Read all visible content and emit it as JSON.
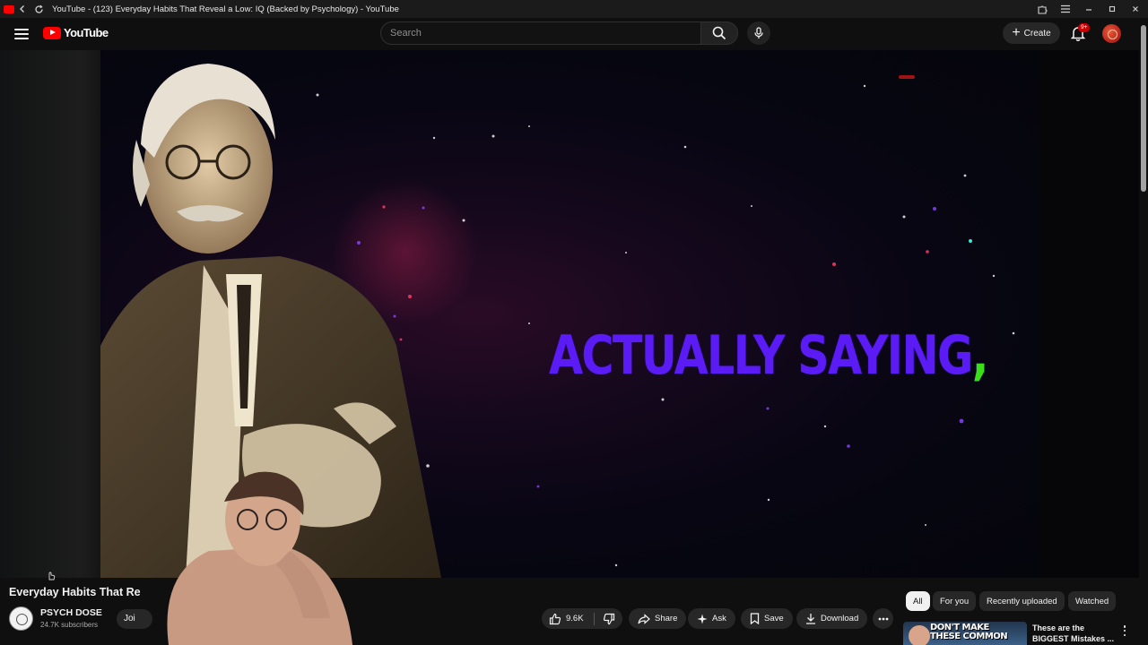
{
  "window": {
    "title": "YouTube - (123) Everyday Habits That Reveal a Low: IQ (Backed by Psychology) - YouTube"
  },
  "masthead": {
    "logo_text": "YouTube",
    "search_placeholder": "Search",
    "create_label": "Create",
    "notification_count": "9+"
  },
  "player": {
    "caption_text": "ACTUALLY SAYING",
    "caption_punct": ",",
    "caption_color": "#5a1bf4",
    "punct_color": "#39e01a"
  },
  "video": {
    "title": "Everyday Habits That Re",
    "channel_name": "PSYCH DOSE",
    "channel_subs": "24.7K subscribers",
    "join_label": "Joi"
  },
  "actions": {
    "like_count": "9.6K",
    "share_label": "Share",
    "ask_label": "Ask",
    "save_label": "Save",
    "download_label": "Download"
  },
  "chips": [
    "All",
    "For you",
    "Recently uploaded",
    "Watched"
  ],
  "recommendation": {
    "thumb_text": "DON'T MAKE\nTHESE COMMON",
    "title": "These are the\nBIGGEST Mistakes ..."
  },
  "colors": {
    "brand_red": "#ff0000",
    "background": "#0f0f0f",
    "chip_bg": "#272727"
  }
}
